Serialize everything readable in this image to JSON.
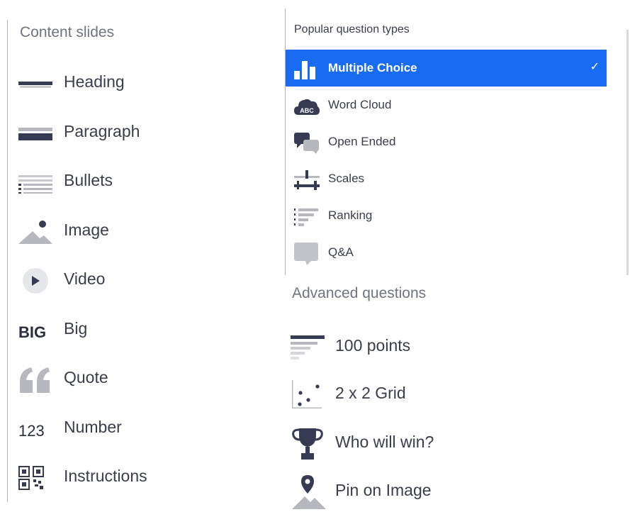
{
  "content_slides": {
    "title": "Content slides",
    "items": [
      {
        "label": "Heading",
        "icon": "heading-icon"
      },
      {
        "label": "Paragraph",
        "icon": "paragraph-icon"
      },
      {
        "label": "Bullets",
        "icon": "bullets-icon"
      },
      {
        "label": "Image",
        "icon": "image-icon"
      },
      {
        "label": "Video",
        "icon": "video-icon"
      },
      {
        "label": "Big",
        "icon": "big-icon",
        "icon_text": "BIG"
      },
      {
        "label": "Quote",
        "icon": "quote-icon"
      },
      {
        "label": "Number",
        "icon": "number-icon",
        "icon_text": "123"
      },
      {
        "label": "Instructions",
        "icon": "qr-code-icon"
      }
    ]
  },
  "popular": {
    "title": "Popular question types",
    "items": [
      {
        "label": "Multiple Choice",
        "icon": "bar-chart-icon",
        "selected": true,
        "check": "✓"
      },
      {
        "label": "Word Cloud",
        "icon": "word-cloud-icon",
        "icon_text": "ABC"
      },
      {
        "label": "Open Ended",
        "icon": "speech-bubbles-icon"
      },
      {
        "label": "Scales",
        "icon": "sliders-icon"
      },
      {
        "label": "Ranking",
        "icon": "ranking-icon"
      },
      {
        "label": "Q&A",
        "icon": "qa-bubble-icon"
      }
    ]
  },
  "advanced": {
    "title": "Advanced questions",
    "items": [
      {
        "label": "100 points",
        "icon": "points-bars-icon"
      },
      {
        "label": "2 x 2 Grid",
        "icon": "grid-scatter-icon"
      },
      {
        "label": "Who will win?",
        "icon": "trophy-icon"
      },
      {
        "label": "Pin on Image",
        "icon": "pin-on-image-icon"
      }
    ]
  },
  "colors": {
    "accent": "#196cf2",
    "icon_dark": "#363b53",
    "icon_gray": "#b6b8be",
    "text": "#3a3d4a",
    "muted": "#707380"
  }
}
